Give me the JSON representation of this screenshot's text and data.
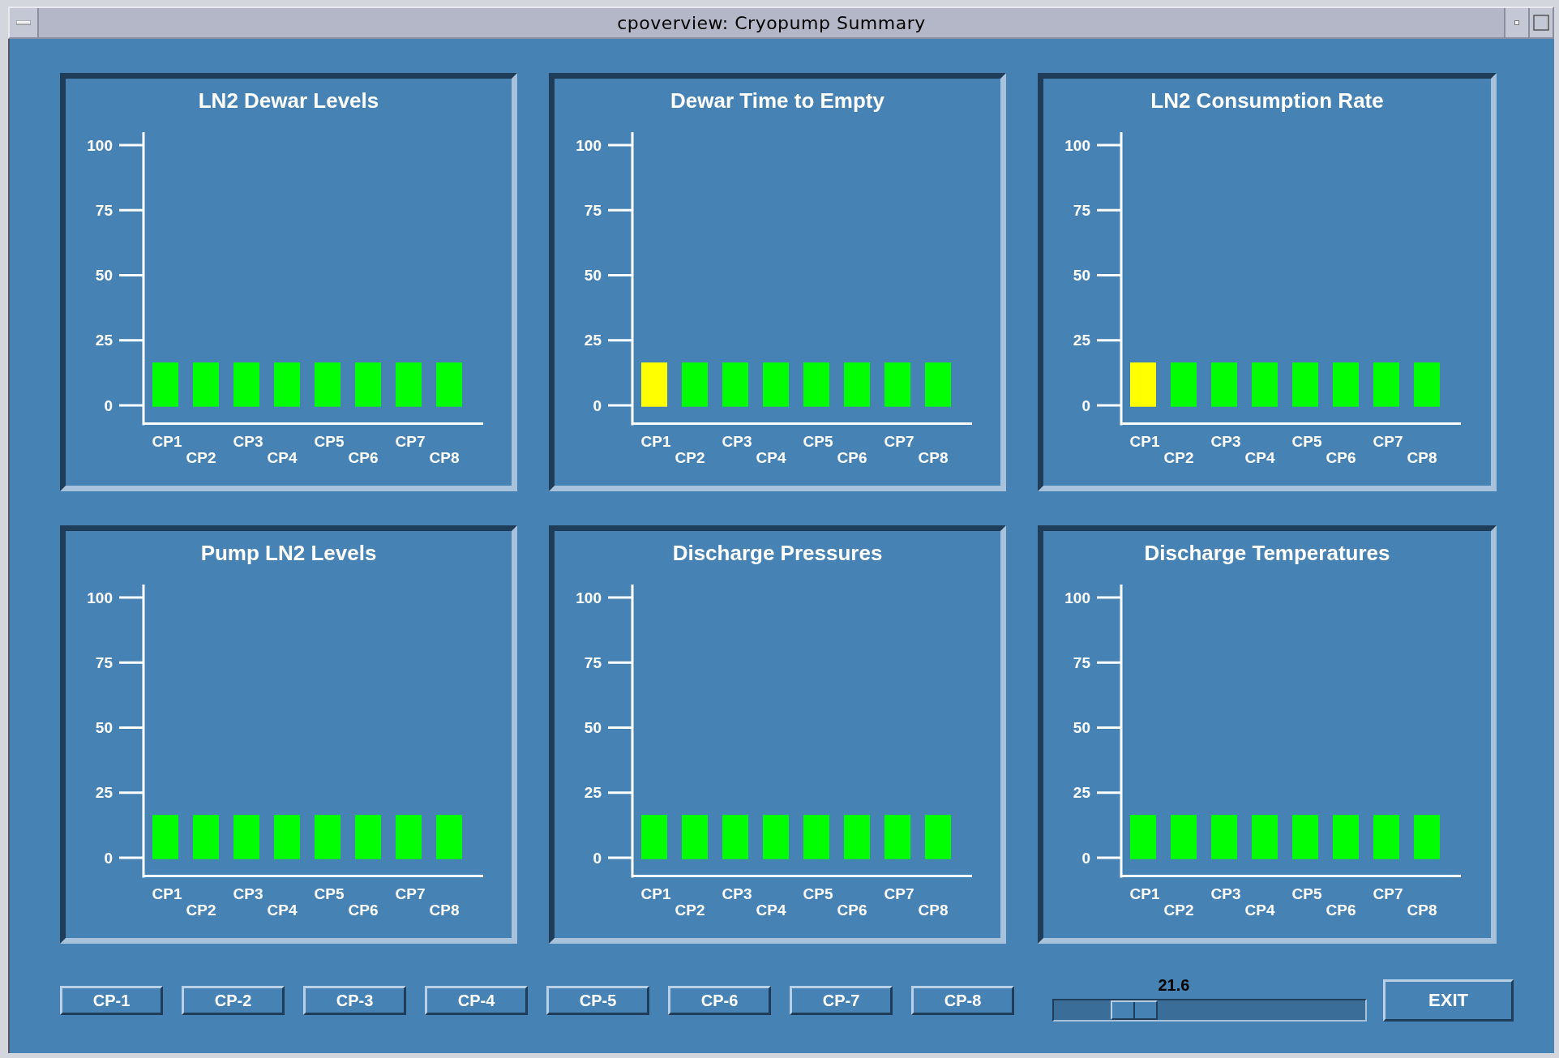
{
  "window": {
    "title": "cpoverview: Cryopump Summary"
  },
  "panels": [
    {
      "title": "LN2 Dewar Levels",
      "chart_data": {
        "type": "bar",
        "categories": [
          "CP1",
          "CP2",
          "CP3",
          "CP4",
          "CP5",
          "CP6",
          "CP7",
          "CP8"
        ],
        "values": [
          17,
          17,
          17,
          17,
          17,
          17,
          17,
          17
        ],
        "colors": [
          "#00ff00",
          "#00ff00",
          "#00ff00",
          "#00ff00",
          "#00ff00",
          "#00ff00",
          "#00ff00",
          "#00ff00"
        ],
        "ylim": [
          -7,
          105
        ],
        "yticks": [
          0,
          25,
          50,
          75,
          100
        ]
      }
    },
    {
      "title": "Dewar Time to Empty",
      "chart_data": {
        "type": "bar",
        "categories": [
          "CP1",
          "CP2",
          "CP3",
          "CP4",
          "CP5",
          "CP6",
          "CP7",
          "CP8"
        ],
        "values": [
          17,
          17,
          17,
          17,
          17,
          17,
          17,
          17
        ],
        "colors": [
          "#ffff00",
          "#00ff00",
          "#00ff00",
          "#00ff00",
          "#00ff00",
          "#00ff00",
          "#00ff00",
          "#00ff00"
        ],
        "ylim": [
          -7,
          105
        ],
        "yticks": [
          0,
          25,
          50,
          75,
          100
        ]
      }
    },
    {
      "title": "LN2 Consumption Rate",
      "chart_data": {
        "type": "bar",
        "categories": [
          "CP1",
          "CP2",
          "CP3",
          "CP4",
          "CP5",
          "CP6",
          "CP7",
          "CP8"
        ],
        "values": [
          17,
          17,
          17,
          17,
          17,
          17,
          17,
          17
        ],
        "colors": [
          "#ffff00",
          "#00ff00",
          "#00ff00",
          "#00ff00",
          "#00ff00",
          "#00ff00",
          "#00ff00",
          "#00ff00"
        ],
        "ylim": [
          -7,
          105
        ],
        "yticks": [
          0,
          25,
          50,
          75,
          100
        ]
      }
    },
    {
      "title": "Pump LN2 Levels",
      "chart_data": {
        "type": "bar",
        "categories": [
          "CP1",
          "CP2",
          "CP3",
          "CP4",
          "CP5",
          "CP6",
          "CP7",
          "CP8"
        ],
        "values": [
          17,
          17,
          17,
          17,
          17,
          17,
          17,
          17
        ],
        "colors": [
          "#00ff00",
          "#00ff00",
          "#00ff00",
          "#00ff00",
          "#00ff00",
          "#00ff00",
          "#00ff00",
          "#00ff00"
        ],
        "ylim": [
          -7,
          105
        ],
        "yticks": [
          0,
          25,
          50,
          75,
          100
        ]
      }
    },
    {
      "title": "Discharge Pressures",
      "chart_data": {
        "type": "bar",
        "categories": [
          "CP1",
          "CP2",
          "CP3",
          "CP4",
          "CP5",
          "CP6",
          "CP7",
          "CP8"
        ],
        "values": [
          17,
          17,
          17,
          17,
          17,
          17,
          17,
          17
        ],
        "colors": [
          "#00ff00",
          "#00ff00",
          "#00ff00",
          "#00ff00",
          "#00ff00",
          "#00ff00",
          "#00ff00",
          "#00ff00"
        ],
        "ylim": [
          -7,
          105
        ],
        "yticks": [
          0,
          25,
          50,
          75,
          100
        ]
      }
    },
    {
      "title": "Discharge Temperatures",
      "chart_data": {
        "type": "bar",
        "categories": [
          "CP1",
          "CP2",
          "CP3",
          "CP4",
          "CP5",
          "CP6",
          "CP7",
          "CP8"
        ],
        "values": [
          17,
          17,
          17,
          17,
          17,
          17,
          17,
          17
        ],
        "colors": [
          "#00ff00",
          "#00ff00",
          "#00ff00",
          "#00ff00",
          "#00ff00",
          "#00ff00",
          "#00ff00",
          "#00ff00"
        ],
        "ylim": [
          -7,
          105
        ],
        "yticks": [
          0,
          25,
          50,
          75,
          100
        ]
      }
    }
  ],
  "pump_buttons": [
    "CP-1",
    "CP-2",
    "CP-3",
    "CP-4",
    "CP-5",
    "CP-6",
    "CP-7",
    "CP-8"
  ],
  "slider": {
    "reading": "21.6",
    "level": 0.216
  },
  "exit_button": "EXIT"
}
